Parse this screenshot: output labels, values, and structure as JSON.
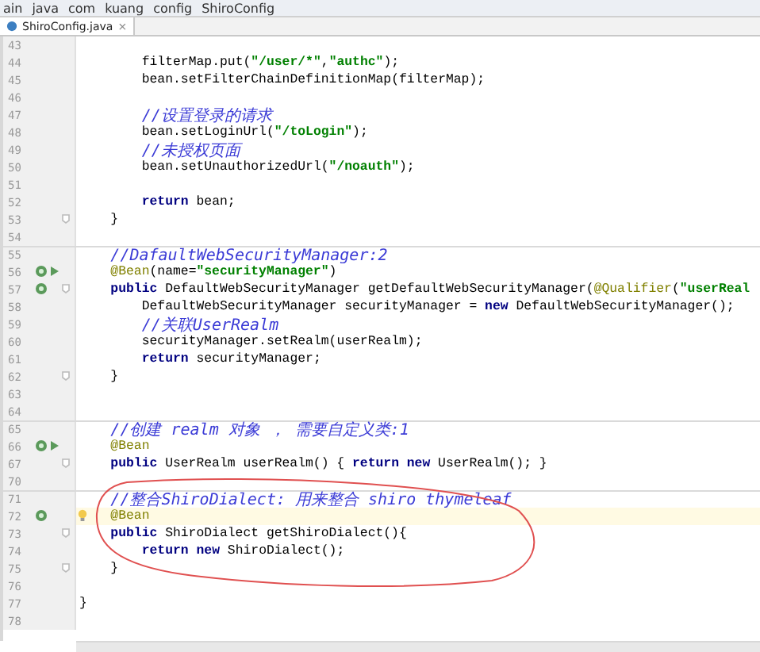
{
  "breadcrumb": [
    "ain",
    "java",
    "com",
    "kuang",
    "config",
    "ShiroConfig"
  ],
  "tabs": [
    {
      "label": "ShiroConfig.java",
      "selected": true,
      "close": "×"
    }
  ],
  "lines": [
    {
      "number": "43"
    },
    {
      "number": "44",
      "tokens": [
        {
          "kind": "plain",
          "text": "        filterMap.put("
        },
        {
          "kind": "string",
          "text": "\"/user/*\""
        },
        {
          "kind": "plain",
          "text": ","
        },
        {
          "kind": "string",
          "text": "\"authc\""
        },
        {
          "kind": "plain",
          "text": ");"
        }
      ]
    },
    {
      "number": "45",
      "tokens": [
        {
          "kind": "plain",
          "text": "        bean.setFilterChainDefinitionMap(filterMap);"
        }
      ]
    },
    {
      "number": "46"
    },
    {
      "number": "47",
      "tokens": [
        {
          "kind": "comment",
          "text": "        //设置登录的请求"
        }
      ]
    },
    {
      "number": "48",
      "tokens": [
        {
          "kind": "plain",
          "text": "        bean.setLoginUrl("
        },
        {
          "kind": "string",
          "text": "\"/toLogin\""
        },
        {
          "kind": "plain",
          "text": ");"
        }
      ]
    },
    {
      "number": "49",
      "tokens": [
        {
          "kind": "comment",
          "text": "        //未授权页面"
        }
      ]
    },
    {
      "number": "50",
      "tokens": [
        {
          "kind": "plain",
          "text": "        bean.setUnauthorizedUrl("
        },
        {
          "kind": "string",
          "text": "\"/noauth\""
        },
        {
          "kind": "plain",
          "text": ");"
        }
      ]
    },
    {
      "number": "51"
    },
    {
      "number": "52",
      "tokens": [
        {
          "kind": "keyword",
          "text": "        return"
        },
        {
          "kind": "plain",
          "text": " bean;"
        }
      ]
    },
    {
      "number": "53",
      "fold": true,
      "tokens": [
        {
          "kind": "plain",
          "text": "    }"
        }
      ]
    },
    {
      "number": "54"
    },
    {
      "number": "55",
      "separator": true,
      "tokens": [
        {
          "kind": "comment",
          "text": "    //DafaultWebSecurityManager:2"
        }
      ]
    },
    {
      "number": "56",
      "bean": true,
      "navigate_arrow": true,
      "tokens": [
        {
          "kind": "annotation",
          "text": "    @Bean"
        },
        {
          "kind": "plain",
          "text": "(name="
        },
        {
          "kind": "string",
          "text": "\"securityManager\""
        },
        {
          "kind": "plain",
          "text": ")"
        }
      ]
    },
    {
      "number": "57",
      "bean": true,
      "fold": true,
      "tokens": [
        {
          "kind": "keyword",
          "text": "    public"
        },
        {
          "kind": "plain",
          "text": " DefaultWebSecurityManager getDefaultWebSecurityManager("
        },
        {
          "kind": "annotation",
          "text": "@Qualifier"
        },
        {
          "kind": "plain",
          "text": "("
        },
        {
          "kind": "string",
          "text": "\"userReal"
        }
      ]
    },
    {
      "number": "58",
      "tokens": [
        {
          "kind": "plain",
          "text": "        DefaultWebSecurityManager securityManager = "
        },
        {
          "kind": "keyword",
          "text": "new"
        },
        {
          "kind": "plain",
          "text": " DefaultWebSecurityManager();"
        }
      ]
    },
    {
      "number": "59",
      "tokens": [
        {
          "kind": "comment",
          "text": "        //关联UserRealm"
        }
      ]
    },
    {
      "number": "60",
      "tokens": [
        {
          "kind": "plain",
          "text": "        securityManager.setRealm(userRealm);"
        }
      ]
    },
    {
      "number": "61",
      "tokens": [
        {
          "kind": "keyword",
          "text": "        return"
        },
        {
          "kind": "plain",
          "text": " securityManager;"
        }
      ]
    },
    {
      "number": "62",
      "fold": true,
      "tokens": [
        {
          "kind": "plain",
          "text": "    }"
        }
      ]
    },
    {
      "number": "63"
    },
    {
      "number": "64"
    },
    {
      "number": "65",
      "separator": true,
      "tokens": [
        {
          "kind": "comment",
          "text": "    //创建 realm 对象 ， 需要自定义类:1"
        }
      ]
    },
    {
      "number": "66",
      "bean": true,
      "navigate_arrow": true,
      "tokens": [
        {
          "kind": "annotation",
          "text": "    @Bean"
        }
      ]
    },
    {
      "number": "67",
      "fold": true,
      "tokens": [
        {
          "kind": "keyword",
          "text": "    public"
        },
        {
          "kind": "plain",
          "text": " UserRealm userRealm() { "
        },
        {
          "kind": "keyword",
          "text": "return new"
        },
        {
          "kind": "plain",
          "text": " UserRealm(); }"
        }
      ]
    },
    {
      "number": "70"
    },
    {
      "number": "71",
      "separator": true,
      "tokens": [
        {
          "kind": "comment",
          "text": "    //整合ShiroDialect: 用来整合 shiro thymeleaf"
        }
      ]
    },
    {
      "number": "72",
      "bean": true,
      "current": true,
      "bulb": true,
      "tokens": [
        {
          "kind": "annotation",
          "text": "    @Bean"
        }
      ]
    },
    {
      "number": "73",
      "fold": true,
      "tokens": [
        {
          "kind": "keyword",
          "text": "    public"
        },
        {
          "kind": "plain",
          "text": " ShiroDialect getShiroDialect(){"
        }
      ]
    },
    {
      "number": "74",
      "tokens": [
        {
          "kind": "keyword",
          "text": "        return new"
        },
        {
          "kind": "plain",
          "text": " ShiroDialect();"
        }
      ]
    },
    {
      "number": "75",
      "fold": true,
      "tokens": [
        {
          "kind": "plain",
          "text": "    }"
        }
      ]
    },
    {
      "number": "76"
    },
    {
      "number": "77",
      "tokens": [
        {
          "kind": "plain",
          "text": "}"
        }
      ]
    },
    {
      "number": "78"
    }
  ]
}
